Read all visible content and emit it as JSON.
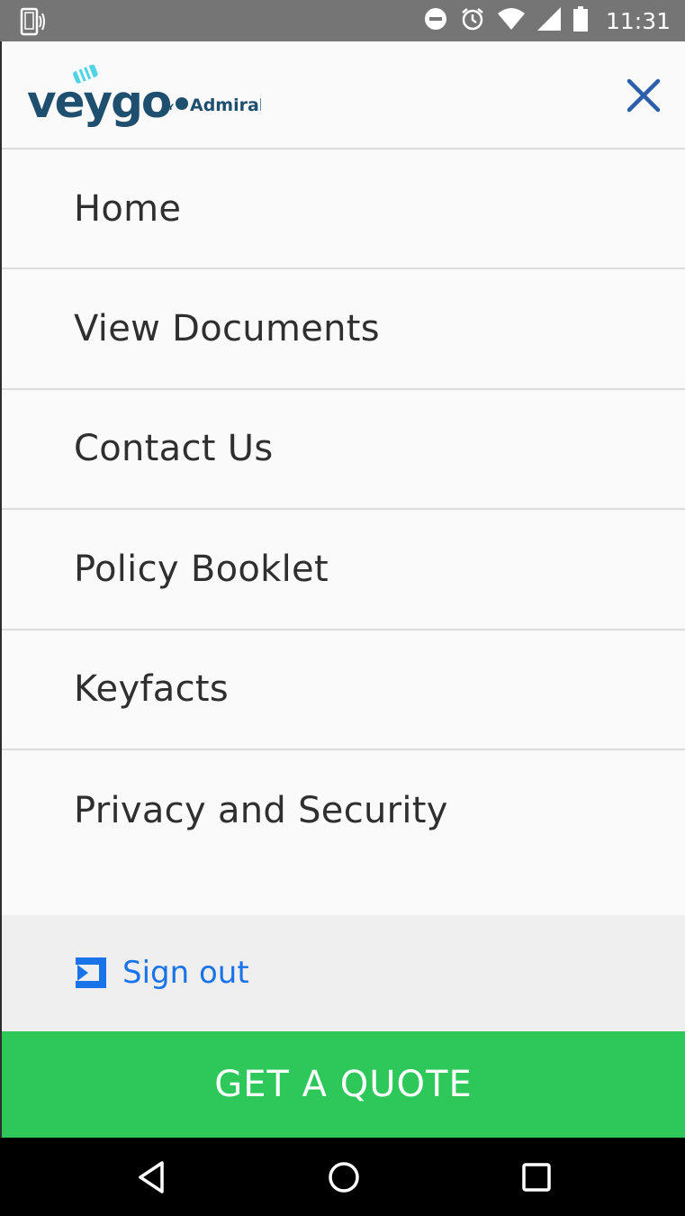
{
  "status_bar": {
    "time": "11:31",
    "icons": [
      "vibrate-phone-icon",
      "do-not-disturb-icon",
      "alarm-icon",
      "wifi-icon",
      "signal-icon",
      "battery-icon"
    ]
  },
  "header": {
    "logo_text": "veygo",
    "logo_by": "BY",
    "logo_partner": "Admiral",
    "close_icon": "close-icon"
  },
  "menu": {
    "items": [
      {
        "label": "Home"
      },
      {
        "label": "View Documents"
      },
      {
        "label": "Contact Us"
      },
      {
        "label": "Policy Booklet"
      },
      {
        "label": "Keyfacts"
      },
      {
        "label": "Privacy and Security"
      }
    ]
  },
  "signout": {
    "label": "Sign out",
    "icon": "sign-out-icon"
  },
  "cta": {
    "label": "GET A QUOTE"
  },
  "nav_bar": {
    "icons": [
      "back-icon",
      "home-icon",
      "recents-icon"
    ]
  },
  "colors": {
    "accent_blue": "#1a73e8",
    "brand_navy": "#1f4f6f",
    "brand_cyan": "#4fd3e6",
    "cta_green": "#2ec85a",
    "status_gray": "#757575"
  }
}
